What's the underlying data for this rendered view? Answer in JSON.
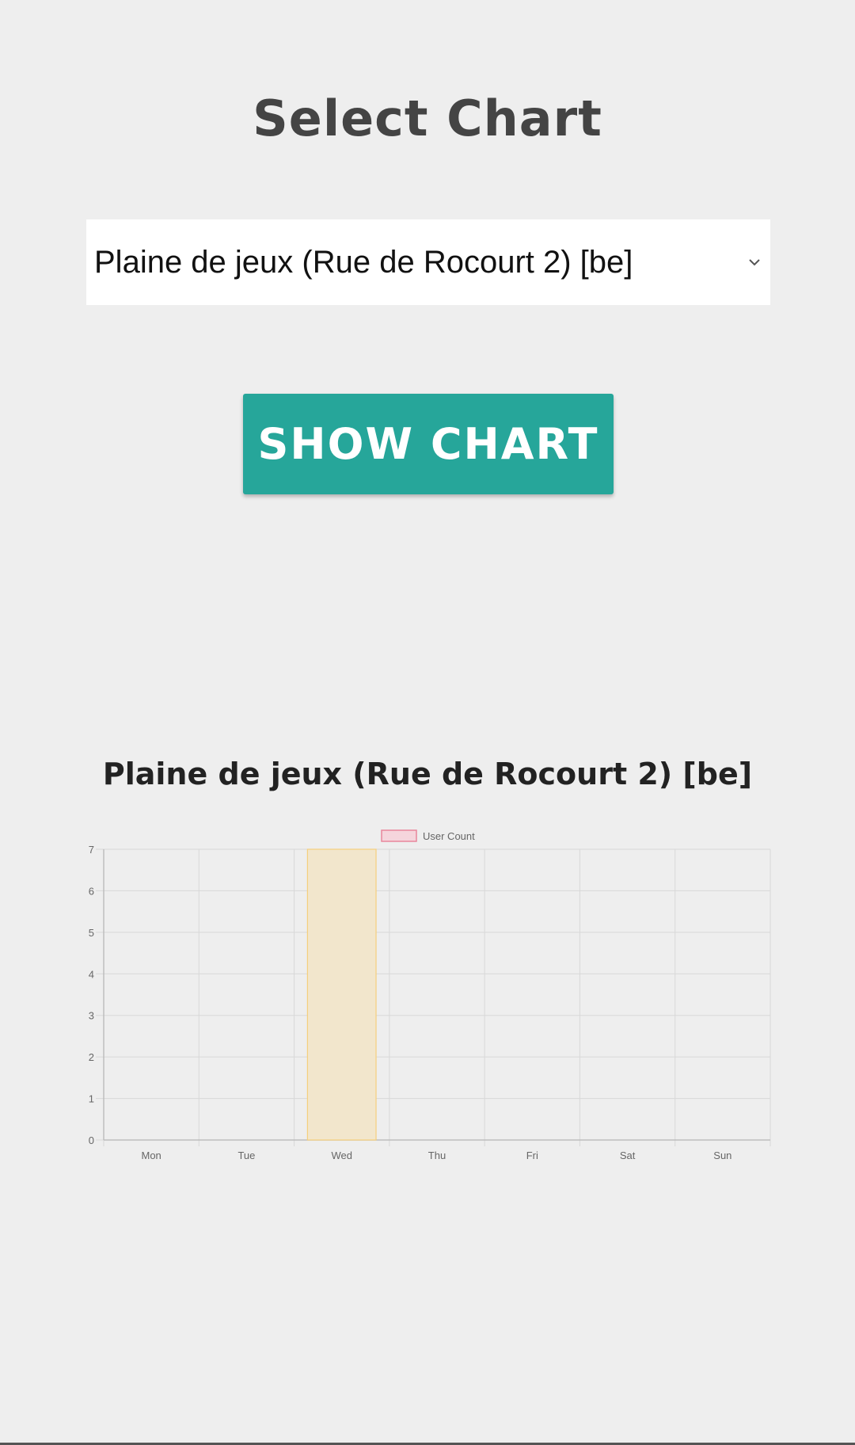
{
  "header": {
    "title": "Select Chart"
  },
  "chart_select": {
    "selected_value": "Plaine de jeux (Rue de Rocourt 2) [be]",
    "icon": "chevron-down-icon"
  },
  "actions": {
    "show_chart_label": "SHOW CHART",
    "button_color": "#26a69a"
  },
  "chart_section": {
    "heading": "Plaine de jeux (Rue de Rocourt 2) [be]"
  },
  "chart_data": {
    "type": "bar",
    "categories": [
      "Mon",
      "Tue",
      "Wed",
      "Thu",
      "Fri",
      "Sat",
      "Sun"
    ],
    "series": [
      {
        "name": "User Count",
        "values": [
          0,
          0,
          7,
          0,
          0,
          0,
          0
        ]
      }
    ],
    "ylim": [
      0,
      7
    ],
    "yticks": [
      "0",
      "1",
      "2",
      "3",
      "4",
      "5",
      "6",
      "7"
    ],
    "grid": true,
    "legend_position": "top-center",
    "colors": {
      "legend_fill": "#f5d5dc",
      "legend_border": "#e8869c",
      "bar_fill": "#f2e6cc",
      "bar_border": "#f5cf7d",
      "grid": "#d8d8d8",
      "axis_text": "#666666"
    }
  }
}
